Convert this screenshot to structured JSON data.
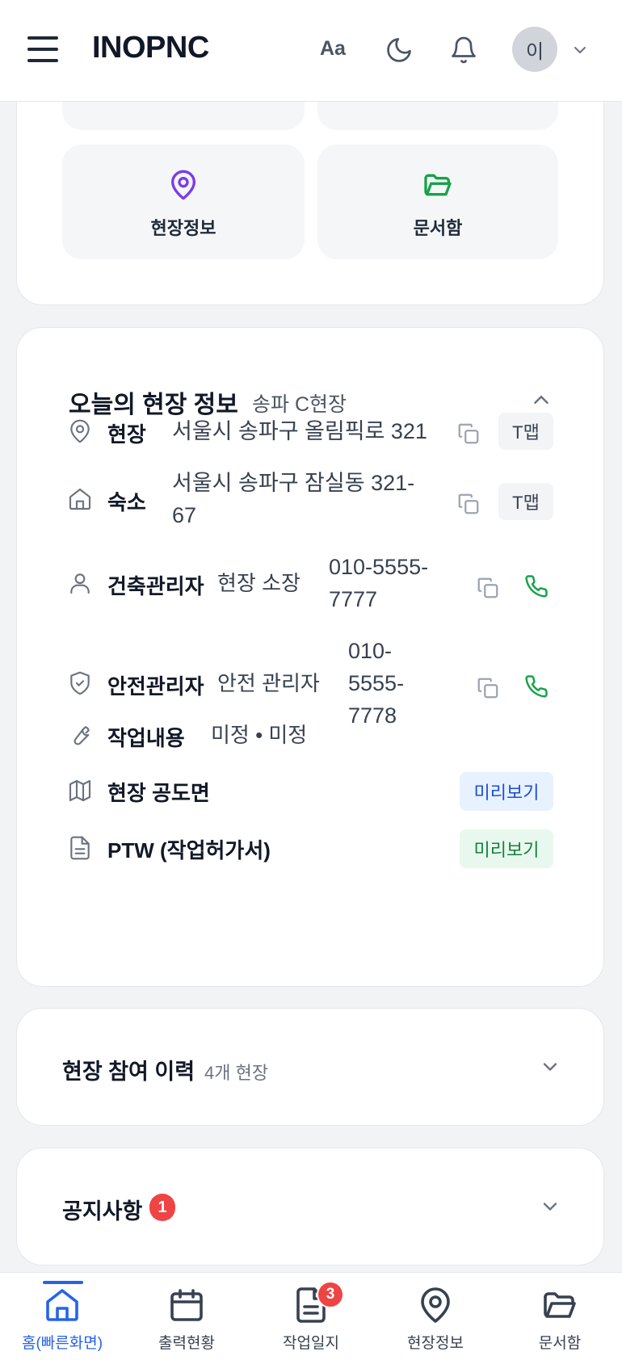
{
  "header": {
    "brand": "INOPNC",
    "font_toggle": "Aa",
    "avatar_initial": "이"
  },
  "quick_menu": {
    "tiles": [
      {
        "label": "현장정보",
        "icon": "map-pin-icon",
        "color": "#7c3aed"
      },
      {
        "label": "문서함",
        "icon": "folder-open-icon",
        "color": "#16a34a"
      }
    ]
  },
  "site_info": {
    "title": "오늘의 현장 정보",
    "site_name": "송파 C현장",
    "rows": {
      "site": {
        "label": "현장",
        "value": "서울시 송파구 올림픽로 321",
        "action": "T맵"
      },
      "lodging": {
        "label": "숙소",
        "value": "서울시 송파구 잠실동 321-67",
        "action": "T맵"
      },
      "building_manager": {
        "label": "건축관리자",
        "role": "현장 소장",
        "phone": "010-5555-7777"
      },
      "safety_manager": {
        "label": "안전관리자",
        "role": "안전 관리자",
        "phone": "010-5555-7778"
      },
      "work": {
        "label": "작업내용",
        "value": "미정 • 미정"
      },
      "drawing": {
        "label": "현장 공도면",
        "action": "미리보기"
      },
      "ptw": {
        "label": "PTW (작업허가서)",
        "action": "미리보기"
      }
    }
  },
  "history": {
    "title": "현장 참여 이력",
    "count": "4개 현장"
  },
  "notice": {
    "title": "공지사항",
    "badge": "1"
  },
  "bottom_nav": {
    "items": [
      {
        "label": "홈(빠른화면)",
        "icon": "home-icon"
      },
      {
        "label": "출력현황",
        "icon": "calendar-icon"
      },
      {
        "label": "작업일지",
        "icon": "document-icon"
      },
      {
        "label": "현장정보",
        "icon": "map-pin-icon"
      },
      {
        "label": "문서함",
        "icon": "folder-open-icon"
      }
    ],
    "worklog_badge": "3"
  },
  "colors": {
    "accent": "#2563eb",
    "danger": "#ef4444",
    "phone": "#16a34a"
  }
}
